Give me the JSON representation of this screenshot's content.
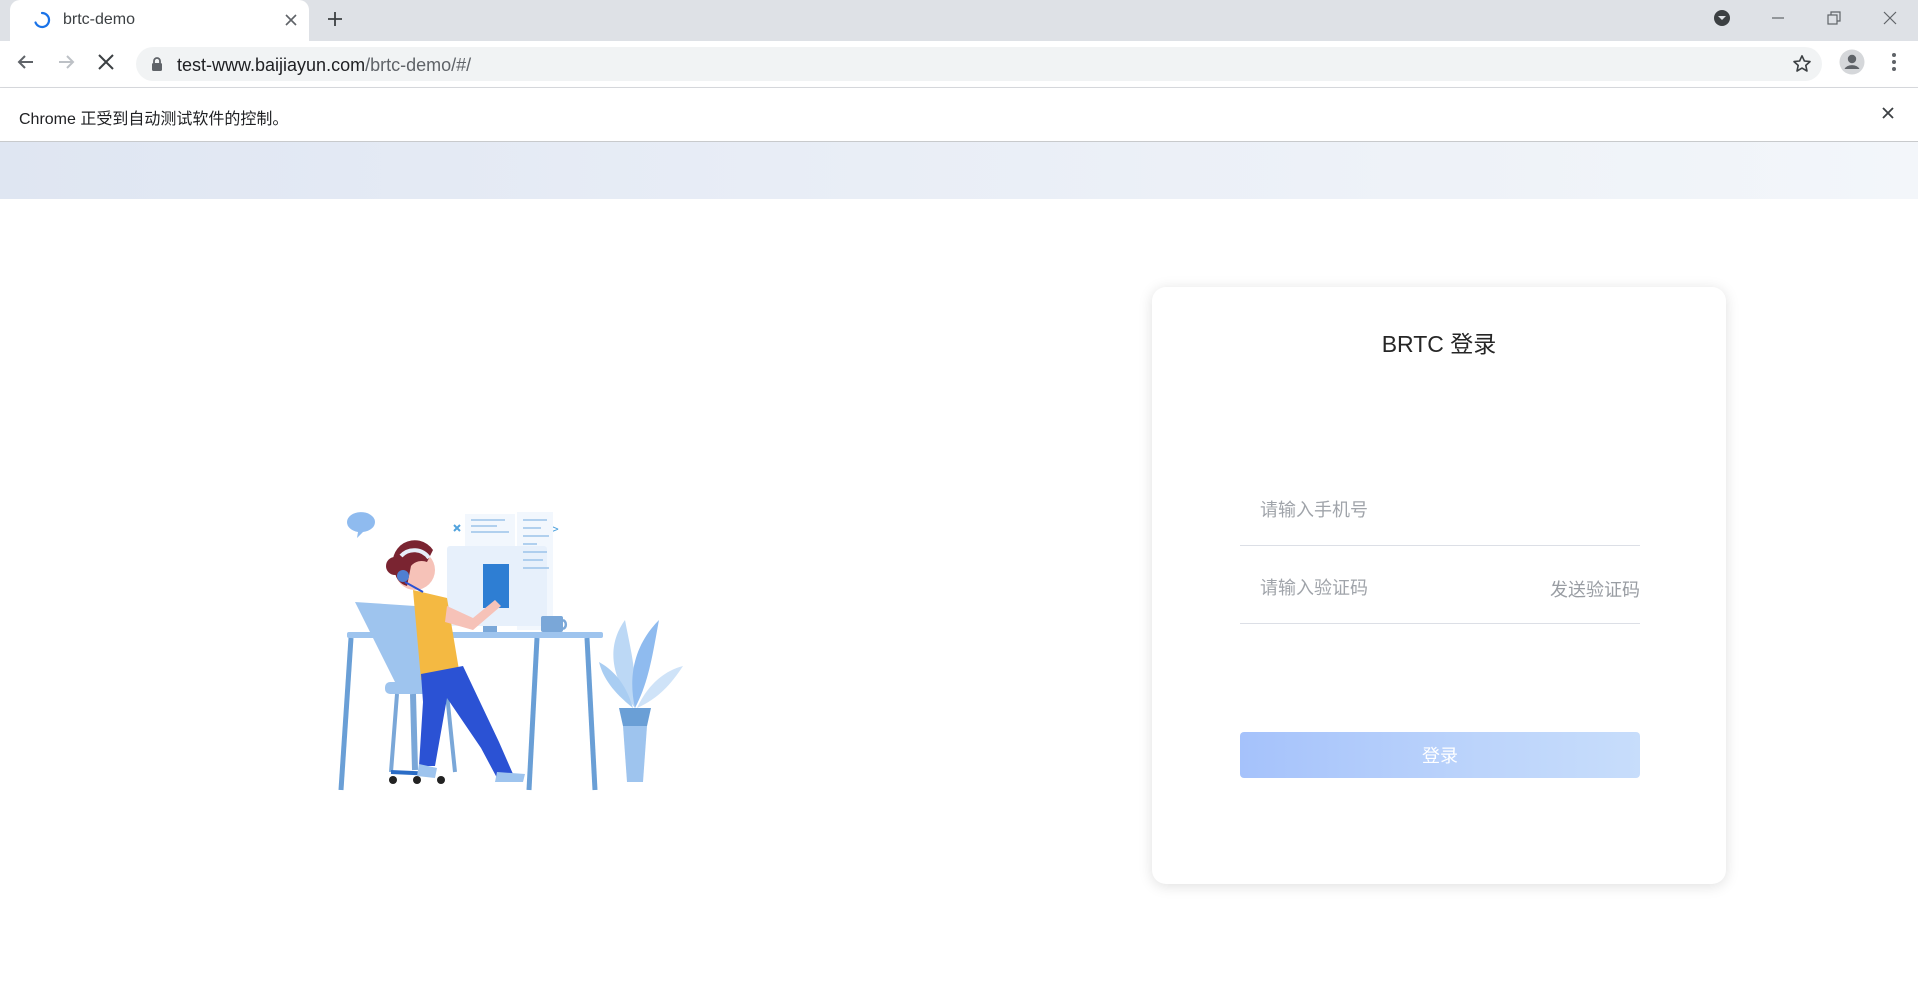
{
  "browser": {
    "tab": {
      "title": "brtc-demo"
    },
    "address_bar": {
      "host": "test-www.baijiayun.com",
      "path": "/brtc-demo/#/"
    },
    "infobar": {
      "message": "Chrome 正受到自动测试软件的控制。"
    }
  },
  "login": {
    "title": "BRTC 登录",
    "phone_placeholder": "请输入手机号",
    "phone_value": "",
    "code_placeholder": "请输入验证码",
    "code_value": "",
    "send_code_label": "发送验证码",
    "submit_label": "登录"
  },
  "icons": {
    "tab": [
      "loading-spinner-icon",
      "close-icon",
      "plus-icon"
    ],
    "window": [
      "profile-dropdown-icon",
      "minimize-icon",
      "restore-icon",
      "close-window-icon"
    ],
    "toolbar": [
      "back-arrow-icon",
      "forward-arrow-icon",
      "stop-loading-icon",
      "lock-icon",
      "star-icon",
      "profile-avatar-icon",
      "more-vert-icon"
    ]
  },
  "colors": {
    "accent_blue": "#1a73e8",
    "login_button_start": "#a5c2fb",
    "login_button_end": "#c7ddfb",
    "banner": "#e4eaf4"
  }
}
